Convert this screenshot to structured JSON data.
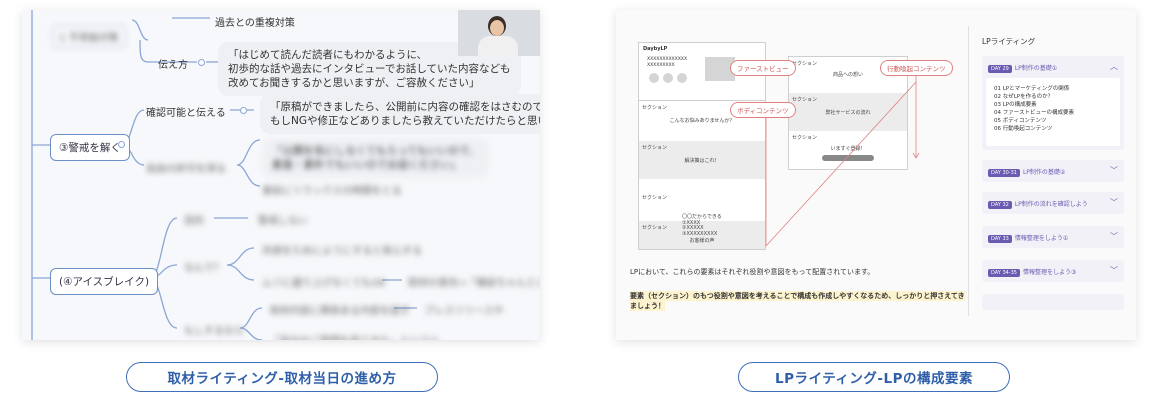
{
  "left": {
    "blur_top": "1 予測後対策",
    "node_overlap": "過去との重複対策",
    "label_tsutaekata": "伝え方",
    "bubble1": [
      "「はじめて読んだ読者にもわかるように、",
      "初歩的な話や過去にインタビューでお話していた内容なども",
      "改めてお聞きするかと思いますが、ご容赦ください」"
    ],
    "node_hasai": "③警戒を解く",
    "label_kakunin": "確認可能と伝える",
    "bubble2": [
      "「原稿ができましたら、公開前に内容の確認をはさむので、",
      "もしNGや修正などありましたら教えていただけたらと思います"
    ],
    "blur_left_a": "自由の許可を得る",
    "blur_bubble_a": [
      "「公開を気にしなくてもらってもいいので、",
      "素直・素朴でもいいのでお話ください」"
    ],
    "blur_sub_a": "事前にリラックスの時間をとる",
    "node_icebreak": "(④アイスブレイク)",
    "blur_ib1a": "目的",
    "blur_ib1b": "警戒しない",
    "blur_ib2a": "なんで？",
    "blur_ib2b": "共感をためにようにすると安心する",
    "blur_ib2c": "ムリに盛り上げなくてもOK",
    "blur_ib2d": "取材の意向→「雑談ちゃんとしている」",
    "blur_ib3a": "もしするなら",
    "blur_ib3b": "取材内容に関係ある内容を話す",
    "blur_ib3c": "プレスリリースや",
    "blur_ib3d": "「自分のご質問を見てきた」というと",
    "has_video": "video-thumbnail"
  },
  "right": {
    "wf_logo": "DaybyLP",
    "wf_title1": "XXXXXXXXXXXXX",
    "wf_title2": "XXXXXXXXX",
    "wf_sections": [
      {
        "label": "セクション",
        "text": "こんなお悩みありませんか？"
      },
      {
        "label": "セクション",
        "text": "解決策はこれ！"
      },
      {
        "label": "セクション",
        "text": "〇〇だからできる\n①XXXX\n②XXXXX\n③XXXXXXXXX"
      },
      {
        "label": "セクション",
        "text": "お客様の声"
      }
    ],
    "wf2_sections": [
      {
        "label": "セクション",
        "text": "商品への想い"
      },
      {
        "label": "セクション",
        "text": "弊社サービスの流れ"
      },
      {
        "label": "セクション",
        "text": "いますぐ登録！"
      }
    ],
    "tags": {
      "first_view": "ファーストビュー",
      "body": "ボディコンテンツ",
      "action": "行動喚起コンテンツ"
    },
    "para1": "LPにおいて、これらの要素はそれぞれ役割や意図をもって配置されています。",
    "para2a": "要素（セクション）のもつ役割や意図を考えることで構成も作成しやすくなるため、しっかりと押さえてき",
    "para2b": "ましょう！",
    "sidebar_title": "LPライティング",
    "accordion": [
      {
        "day": "DAY 29",
        "label": "LP制作の基礎①",
        "open": true
      },
      {
        "day": "DAY 30-31",
        "label": "LP制作の基礎②",
        "open": false
      },
      {
        "day": "DAY 32",
        "label": "LP制作の流れを確認しよう",
        "open": false
      },
      {
        "day": "DAY 33",
        "label": "情報整理をしよう①",
        "open": false
      },
      {
        "day": "DAY 34-35",
        "label": "情報整理をしよう③",
        "open": false
      }
    ],
    "toc": [
      "01 LPとマーケティングの関係",
      "02 なぜLPを作るのか？",
      "03 LPの構成要素",
      "04 ファーストビューの構成要素",
      "05 ボディコンテンツ",
      "06 行動喚起コンテンツ"
    ],
    "chevron_up": "︿",
    "chevron_down": "﹀"
  },
  "captions": {
    "left": "取材ライティング-取材当日の進め方",
    "right": "LPライティング-LPの構成要素"
  },
  "colors": {
    "accent_blue": "#3f6fb8",
    "mindmap_line": "#8aa6d4",
    "lp_purple": "#6a5ab0",
    "tag_red": "#d05555"
  }
}
